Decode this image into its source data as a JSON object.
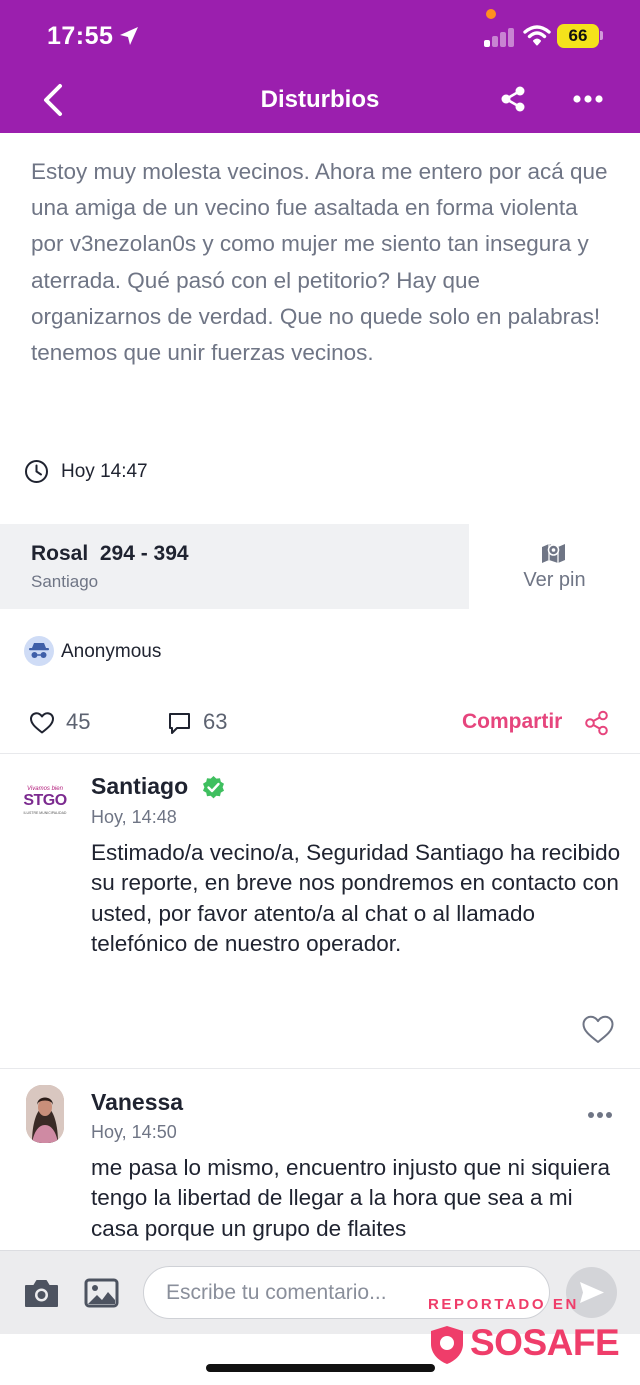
{
  "status_bar": {
    "time": "17:55",
    "battery": "66"
  },
  "header": {
    "title": "Disturbios"
  },
  "post": {
    "text": "Estoy muy molesta vecinos. Ahora me entero por acá que una amiga de un vecino fue asaltada en forma violenta por v3nezolan0s y como mujer me siento tan insegura y aterrada. Qué pasó con el petitorio? Hay que organizarnos de verdad. Que no quede solo en palabras! tenemos que unir fuerzas vecinos.",
    "time": "Hoy 14:47",
    "address": {
      "street": "Rosal  294 - 394",
      "city": "Santiago",
      "pin_label": "Ver pin"
    },
    "author": "Anonymous",
    "likes": "45",
    "comments": "63",
    "share_label": "Compartir"
  },
  "comments": [
    {
      "author": "Santiago",
      "logo_small": "Vivamos bien",
      "logo_main": "STGO",
      "logo_sub": "ILUSTRE MUNICIPALIDAD",
      "verified": true,
      "time": "Hoy, 14:48",
      "text": "Estimado/a vecino/a, Seguridad Santiago ha recibido su reporte, en breve nos pondremos en contacto con usted, por favor atento/a al chat o al llamado telefónico de nuestro operador."
    },
    {
      "author": "Vanessa",
      "time": "Hoy, 14:50",
      "text": "me pasa lo mismo, encuentro injusto que ni siquiera tengo la libertad de llegar a la hora que sea a mi casa porque un grupo de flaites"
    }
  ],
  "input": {
    "placeholder": "Escribe tu comentario..."
  },
  "watermark": {
    "line1": "REPORTADO EN",
    "brand": "SOSAFE"
  },
  "colors": {
    "header": "#9b1fae",
    "accent": "#e6457d",
    "verified": "#3fbf5f",
    "battery": "#f5e21b"
  },
  "icons": [
    "location-arrow-icon",
    "signal-icon",
    "wifi-icon",
    "battery-icon",
    "back-icon",
    "share-icon",
    "more-icon",
    "clock-icon",
    "map-icon",
    "incognito-icon",
    "heart-icon",
    "comment-icon",
    "verified-icon",
    "camera-icon",
    "gallery-icon",
    "send-icon",
    "shield-icon"
  ]
}
